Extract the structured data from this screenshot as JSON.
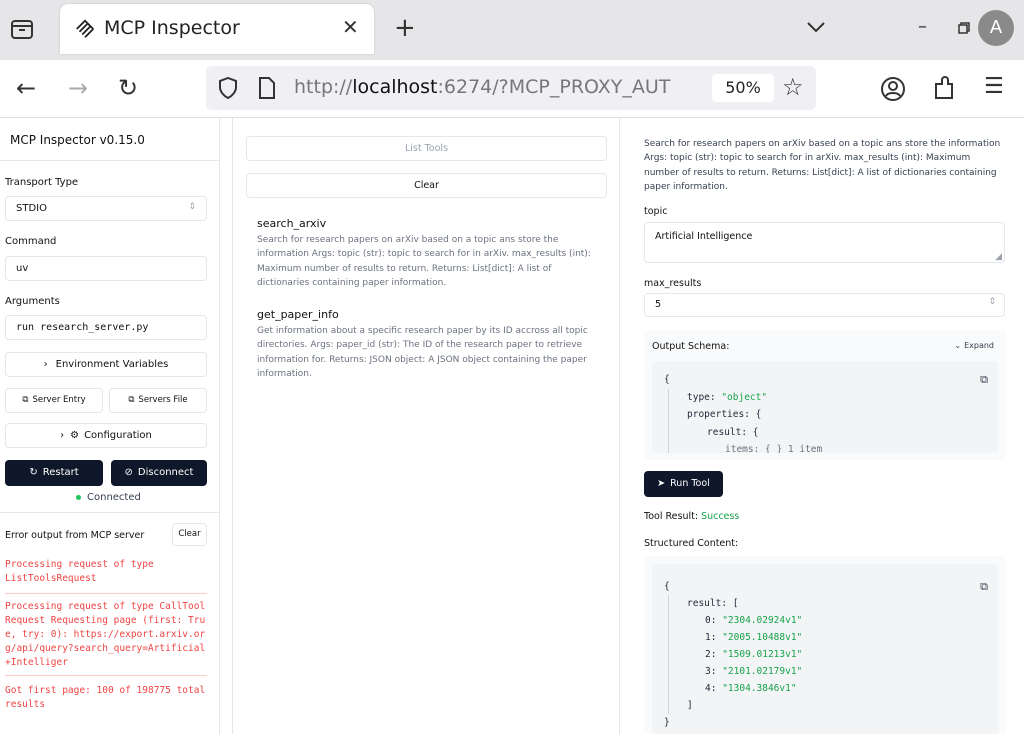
{
  "browser": {
    "tab_title": "MCP Inspector",
    "url_host": "localhost",
    "url_prefix": "http://",
    "url_suffix": ":6274/?MCP_PROXY_AUT",
    "zoom": "50%"
  },
  "sidebar": {
    "title": "MCP Inspector v0.15.0",
    "transport_label": "Transport Type",
    "transport_value": "STDIO",
    "command_label": "Command",
    "command_value": "uv",
    "arguments_label": "Arguments",
    "arguments_value": "run research_server.py",
    "env_button": "Environment Variables",
    "server_entry_button": "Server Entry",
    "servers_file_button": "Servers File",
    "configuration_button": "Configuration",
    "restart_button": "Restart",
    "disconnect_button": "Disconnect",
    "status": "Connected",
    "error_title": "Error output from MCP server",
    "clear_button": "Clear",
    "errors": [
      "Processing request of type ListToolsRequest",
      "Processing request of type CallToolRequest Requesting page (first: True, try: 0): https://export.arxiv.org/api/query?search_query=Artificial+Intelliger",
      "Got first page: 100 of 198775 total results"
    ]
  },
  "tools_panel": {
    "list_button": "List Tools",
    "clear_button": "Clear",
    "tools": [
      {
        "name": "search_arxiv",
        "description": "Search for research papers on arXiv based on a topic ans store the information Args: topic (str): topic to search for in arXiv. max_results (int): Maximum number of results to return. Returns: List[dict]: A list of dictionaries containing paper information."
      },
      {
        "name": "get_paper_info",
        "description": "Get information about a specific research paper by its ID accross all topic directories. Args: paper_id (str): The ID of the research paper to retrieve information for. Returns: JSON object: A JSON object containing the paper information."
      }
    ]
  },
  "tool_detail": {
    "description": "Search for research papers on arXiv based on a topic ans store the information Args: topic (str): topic to search for in arXiv. max_results (int): Maximum number of results to return. Returns: List[dict]: A list of dictionaries containing paper information.",
    "topic_label": "topic",
    "topic_value": "Artificial Intelligence",
    "max_label": "max_results",
    "max_value": "5",
    "schema_label": "Output Schema:",
    "expand_label": "Expand",
    "schema_lines": [
      "{",
      "type: \"object\"",
      "properties: {",
      "result: {",
      "items: {      } 1 item"
    ],
    "run_button": "Run Tool",
    "result_label": "Tool Result:",
    "result_status": "Success",
    "structured_label": "Structured Content:",
    "result_key": "result: [",
    "results": [
      {
        "idx": "0:",
        "val": "\"2304.02924v1\""
      },
      {
        "idx": "1:",
        "val": "\"2005.10488v1\""
      },
      {
        "idx": "2:",
        "val": "\"1509.01213v1\""
      },
      {
        "idx": "3:",
        "val": "\"2101.02179v1\""
      },
      {
        "idx": "4:",
        "val": "\"1304.3846v1\""
      }
    ],
    "open_brace": "{",
    "close_bracket": "]",
    "close_brace": "}"
  },
  "colors": {
    "accent_dark": "#0f172a",
    "success": "#16a34a",
    "error": "#ef4444"
  }
}
